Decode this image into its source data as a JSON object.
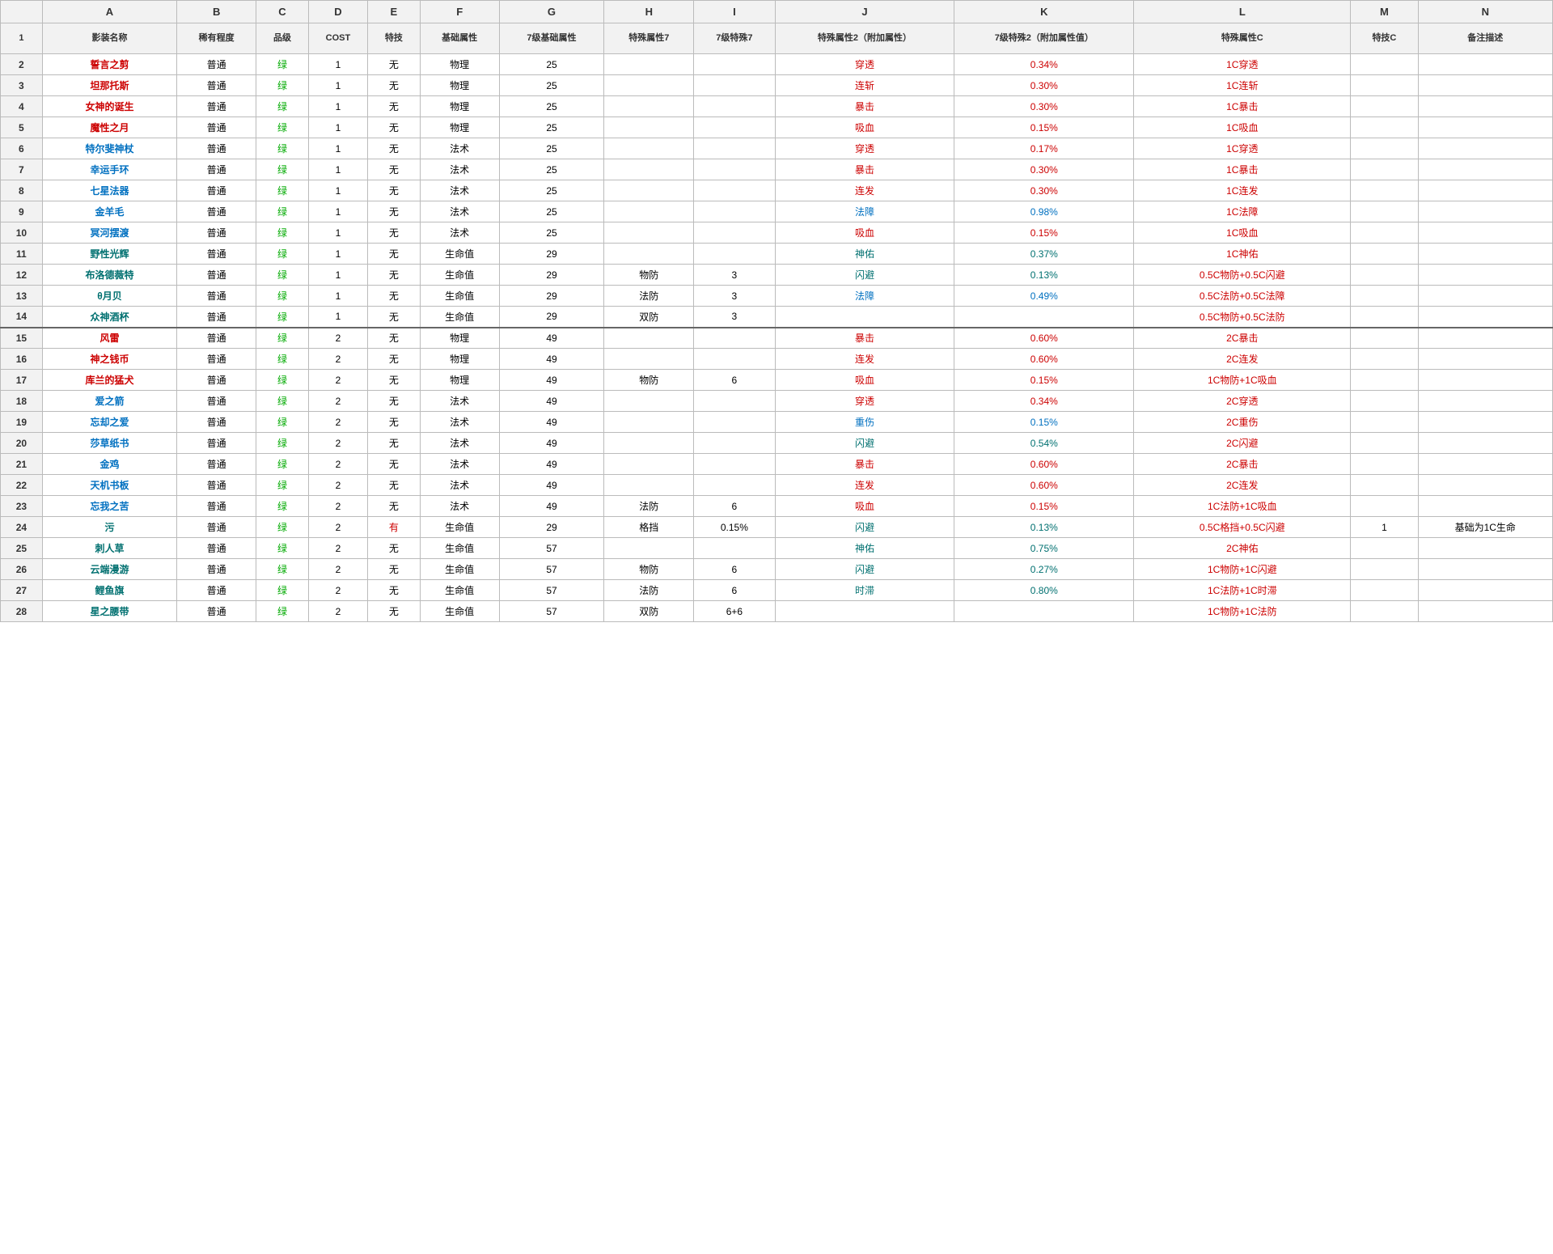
{
  "columns": {
    "row_num": "#",
    "A": "影装名称",
    "B": "稀有程度",
    "C": "品级",
    "D": "COST",
    "E": "特技",
    "F": "基础属性",
    "G": "7级基础属性",
    "H": "特殊属性7",
    "I": "7级特殊7",
    "J": "特殊属性2（附加属性）",
    "K": "7级特殊2（附加属性值）",
    "L": "特殊属性C",
    "M": "特技C",
    "N": "备注描述"
  },
  "rows": [
    {
      "num": "2",
      "A": "誓言之剪",
      "A_color": "red",
      "B": "普通",
      "C": "绿",
      "D": "1",
      "E": "无",
      "F": "物理",
      "G": "25",
      "H": "",
      "I": "",
      "J": "穿透",
      "K": "0.34%",
      "L": "1C穿透",
      "M": "",
      "N": ""
    },
    {
      "num": "3",
      "A": "坦那托斯",
      "A_color": "red",
      "B": "普通",
      "C": "绿",
      "D": "1",
      "E": "无",
      "F": "物理",
      "G": "25",
      "H": "",
      "I": "",
      "J": "连斩",
      "K": "0.30%",
      "L": "1C连斩",
      "M": "",
      "N": ""
    },
    {
      "num": "4",
      "A": "女神的诞生",
      "A_color": "red",
      "B": "普通",
      "C": "绿",
      "D": "1",
      "E": "无",
      "F": "物理",
      "G": "25",
      "H": "",
      "I": "",
      "J": "暴击",
      "K": "0.30%",
      "L": "1C暴击",
      "M": "",
      "N": ""
    },
    {
      "num": "5",
      "A": "魔性之月",
      "A_color": "red",
      "B": "普通",
      "C": "绿",
      "D": "1",
      "E": "无",
      "F": "物理",
      "G": "25",
      "H": "",
      "I": "",
      "J": "吸血",
      "K": "0.15%",
      "L": "1C吸血",
      "M": "",
      "N": ""
    },
    {
      "num": "6",
      "A": "特尔斐神杖",
      "A_color": "blue",
      "B": "普通",
      "C": "绿",
      "D": "1",
      "E": "无",
      "F": "法术",
      "G": "25",
      "H": "",
      "I": "",
      "J": "穿透",
      "K": "0.17%",
      "L": "1C穿透",
      "M": "",
      "N": ""
    },
    {
      "num": "7",
      "A": "幸运手环",
      "A_color": "blue",
      "B": "普通",
      "C": "绿",
      "D": "1",
      "E": "无",
      "F": "法术",
      "G": "25",
      "H": "",
      "I": "",
      "J": "暴击",
      "K": "0.30%",
      "L": "1C暴击",
      "M": "",
      "N": ""
    },
    {
      "num": "8",
      "A": "七星法器",
      "A_color": "blue",
      "B": "普通",
      "C": "绿",
      "D": "1",
      "E": "无",
      "F": "法术",
      "G": "25",
      "H": "",
      "I": "",
      "J": "连发",
      "K": "0.30%",
      "L": "1C连发",
      "M": "",
      "N": ""
    },
    {
      "num": "9",
      "A": "金羊毛",
      "A_color": "blue",
      "B": "普通",
      "C": "绿",
      "D": "1",
      "E": "无",
      "F": "法术",
      "G": "25",
      "H": "",
      "I": "",
      "J": "法障",
      "K": "0.98%",
      "L": "1C法障",
      "M": "",
      "N": ""
    },
    {
      "num": "10",
      "A": "冥河摆渡",
      "A_color": "blue",
      "B": "普通",
      "C": "绿",
      "D": "1",
      "E": "无",
      "F": "法术",
      "G": "25",
      "H": "",
      "I": "",
      "J": "吸血",
      "K": "0.15%",
      "L": "1C吸血",
      "M": "",
      "N": ""
    },
    {
      "num": "11",
      "A": "野性光辉",
      "A_color": "teal",
      "B": "普通",
      "C": "绿",
      "D": "1",
      "E": "无",
      "F": "生命值",
      "G": "29",
      "H": "",
      "I": "",
      "J": "神佑",
      "K": "0.37%",
      "L": "1C神佑",
      "M": "",
      "N": ""
    },
    {
      "num": "12",
      "A": "布洛德薇特",
      "A_color": "teal",
      "B": "普通",
      "C": "绿",
      "D": "1",
      "E": "无",
      "F": "生命值",
      "G": "29",
      "H": "物防",
      "I": "3",
      "J": "闪避",
      "K": "0.13%",
      "L": "0.5C物防+0.5C闪避",
      "M": "",
      "N": ""
    },
    {
      "num": "13",
      "A": "θ月贝",
      "A_color": "teal",
      "B": "普通",
      "C": "绿",
      "D": "1",
      "E": "无",
      "F": "生命值",
      "G": "29",
      "H": "法防",
      "I": "3",
      "J": "法障",
      "K": "0.49%",
      "L": "0.5C法防+0.5C法障",
      "M": "",
      "N": ""
    },
    {
      "num": "14",
      "A": "众神酒杯",
      "A_color": "teal",
      "B": "普通",
      "C": "绿",
      "D": "1",
      "E": "无",
      "F": "生命值",
      "G": "29",
      "H": "双防",
      "I": "3",
      "J": "",
      "K": "",
      "L": "0.5C物防+0.5C法防",
      "M": "",
      "N": ""
    },
    {
      "num": "15",
      "A": "风雷",
      "A_color": "red",
      "B": "普通",
      "C": "绿",
      "D": "2",
      "E": "无",
      "F": "物理",
      "G": "49",
      "H": "",
      "I": "",
      "J": "暴击",
      "K": "0.60%",
      "L": "2C暴击",
      "M": "",
      "N": "",
      "separator": true
    },
    {
      "num": "16",
      "A": "神之钱币",
      "A_color": "red",
      "B": "普通",
      "C": "绿",
      "D": "2",
      "E": "无",
      "F": "物理",
      "G": "49",
      "H": "",
      "I": "",
      "J": "连发",
      "K": "0.60%",
      "L": "2C连发",
      "M": "",
      "N": ""
    },
    {
      "num": "17",
      "A": "库兰的猛犬",
      "A_color": "red",
      "B": "普通",
      "C": "绿",
      "D": "2",
      "E": "无",
      "F": "物理",
      "G": "49",
      "H": "物防",
      "I": "6",
      "J": "吸血",
      "K": "0.15%",
      "L": "1C物防+1C吸血",
      "M": "",
      "N": ""
    },
    {
      "num": "18",
      "A": "爱之箭",
      "A_color": "blue",
      "B": "普通",
      "C": "绿",
      "D": "2",
      "E": "无",
      "F": "法术",
      "G": "49",
      "H": "",
      "I": "",
      "J": "穿透",
      "K": "0.34%",
      "L": "2C穿透",
      "M": "",
      "N": ""
    },
    {
      "num": "19",
      "A": "忘却之爱",
      "A_color": "blue",
      "B": "普通",
      "C": "绿",
      "D": "2",
      "E": "无",
      "F": "法术",
      "G": "49",
      "H": "",
      "I": "",
      "J": "重伤",
      "K": "0.15%",
      "L": "2C重伤",
      "M": "",
      "N": ""
    },
    {
      "num": "20",
      "A": "莎草纸书",
      "A_color": "blue",
      "B": "普通",
      "C": "绿",
      "D": "2",
      "E": "无",
      "F": "法术",
      "G": "49",
      "H": "",
      "I": "",
      "J": "闪避",
      "K": "0.54%",
      "L": "2C闪避",
      "M": "",
      "N": ""
    },
    {
      "num": "21",
      "A": "金鸡",
      "A_color": "blue",
      "B": "普通",
      "C": "绿",
      "D": "2",
      "E": "无",
      "F": "法术",
      "G": "49",
      "H": "",
      "I": "",
      "J": "暴击",
      "K": "0.60%",
      "L": "2C暴击",
      "M": "",
      "N": ""
    },
    {
      "num": "22",
      "A": "天机书板",
      "A_color": "blue",
      "B": "普通",
      "C": "绿",
      "D": "2",
      "E": "无",
      "F": "法术",
      "G": "49",
      "H": "",
      "I": "",
      "J": "连发",
      "K": "0.60%",
      "L": "2C连发",
      "M": "",
      "N": ""
    },
    {
      "num": "23",
      "A": "忘我之苦",
      "A_color": "blue",
      "B": "普通",
      "C": "绿",
      "D": "2",
      "E": "无",
      "F": "法术",
      "G": "49",
      "H": "法防",
      "I": "6",
      "J": "吸血",
      "K": "0.15%",
      "L": "1C法防+1C吸血",
      "M": "",
      "N": ""
    },
    {
      "num": "24",
      "A": "污",
      "A_color": "teal",
      "B": "普通",
      "C": "绿",
      "D": "2",
      "E": "有",
      "F": "生命值",
      "G": "29",
      "H": "格挡",
      "I": "0.15%",
      "J": "闪避",
      "K": "0.13%",
      "L": "0.5C格挡+0.5C闪避",
      "M": "1",
      "N": "基础为1C生命"
    },
    {
      "num": "25",
      "A": "刺人草",
      "A_color": "teal",
      "B": "普通",
      "C": "绿",
      "D": "2",
      "E": "无",
      "F": "生命值",
      "G": "57",
      "H": "",
      "I": "",
      "J": "神佑",
      "K": "0.75%",
      "L": "2C神佑",
      "M": "",
      "N": ""
    },
    {
      "num": "26",
      "A": "云端漫游",
      "A_color": "teal",
      "B": "普通",
      "C": "绿",
      "D": "2",
      "E": "无",
      "F": "生命值",
      "G": "57",
      "H": "物防",
      "I": "6",
      "J": "闪避",
      "K": "0.27%",
      "L": "1C物防+1C闪避",
      "M": "",
      "N": ""
    },
    {
      "num": "27",
      "A": "鲤鱼旗",
      "A_color": "teal",
      "B": "普通",
      "C": "绿",
      "D": "2",
      "E": "无",
      "F": "生命值",
      "G": "57",
      "H": "法防",
      "I": "6",
      "J": "时滞",
      "K": "0.80%",
      "L": "1C法防+1C时滞",
      "M": "",
      "N": ""
    },
    {
      "num": "28",
      "A": "星之腰带",
      "A_color": "teal",
      "B": "普通",
      "C": "绿",
      "D": "2",
      "E": "无",
      "F": "生命值",
      "G": "57",
      "H": "双防",
      "I": "6+6",
      "J": "",
      "K": "",
      "L": "1C物防+1C法防",
      "M": "",
      "N": ""
    }
  ]
}
